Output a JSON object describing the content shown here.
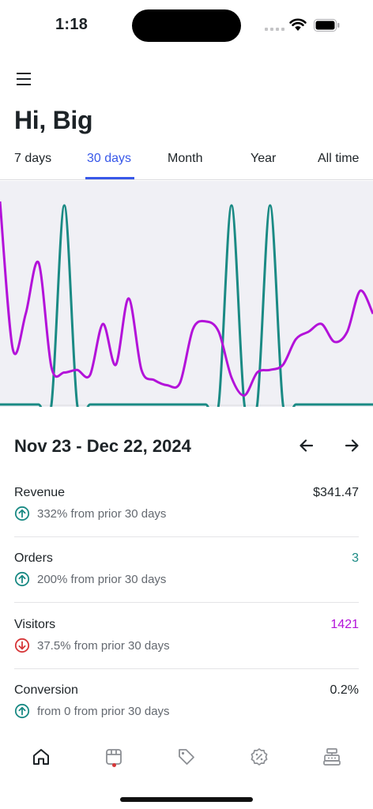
{
  "status_bar": {
    "time": "1:18"
  },
  "header": {
    "greeting": "Hi, Big"
  },
  "tabs": [
    {
      "label": "7 days",
      "active": false
    },
    {
      "label": "30 days",
      "active": true
    },
    {
      "label": "Month",
      "active": false
    },
    {
      "label": "Year",
      "active": false
    },
    {
      "label": "All time",
      "active": false
    }
  ],
  "colors": {
    "accent": "#3858e9",
    "visitors": "#b312d9",
    "orders": "#1a8a84",
    "positive": "#1a8a84",
    "negative": "#d63638"
  },
  "chart_data": {
    "type": "line",
    "series": [
      {
        "name": "Visitors",
        "color": "#b312d9",
        "values": [
          78,
          20,
          34,
          54,
          13,
          11,
          12,
          10,
          30,
          14,
          40,
          12,
          8,
          6,
          7,
          28,
          31,
          27,
          9,
          2,
          11,
          12,
          14,
          24,
          27,
          30,
          23,
          27,
          43,
          34
        ]
      },
      {
        "name": "Orders",
        "color": "#1a8a84",
        "values": [
          0,
          0,
          0,
          0,
          0,
          1,
          0,
          0,
          0,
          0,
          0,
          0,
          0,
          0,
          0,
          0,
          0,
          0,
          1,
          0,
          0,
          1,
          0,
          0,
          0,
          0,
          0,
          0,
          0,
          0
        ]
      }
    ]
  },
  "summary": {
    "range": "Nov 23 - Dec 22, 2024",
    "prev_icon": "arrow-left-icon",
    "next_icon": "arrow-right-icon"
  },
  "stats": [
    {
      "label": "Revenue",
      "value": "$341.47",
      "value_color": "#1d2327",
      "change": "332% from prior 30 days",
      "direction": "up"
    },
    {
      "label": "Orders",
      "value": "3",
      "value_color": "#1a8a84",
      "change": "200% from prior 30 days",
      "direction": "up"
    },
    {
      "label": "Visitors",
      "value": "1421",
      "value_color": "#b312d9",
      "change": "37.5% from prior 30 days",
      "direction": "down"
    },
    {
      "label": "Conversion",
      "value": "0.2%",
      "value_color": "#1d2327",
      "change": "from 0 from prior 30 days",
      "direction": "up"
    }
  ],
  "tabbar": [
    {
      "icon": "home-icon",
      "active": true
    },
    {
      "icon": "orders-box-icon",
      "active": false,
      "has_notification": true
    },
    {
      "icon": "tag-icon",
      "active": false
    },
    {
      "icon": "discount-badge-icon",
      "active": false
    },
    {
      "icon": "cash-register-icon",
      "active": false
    }
  ]
}
